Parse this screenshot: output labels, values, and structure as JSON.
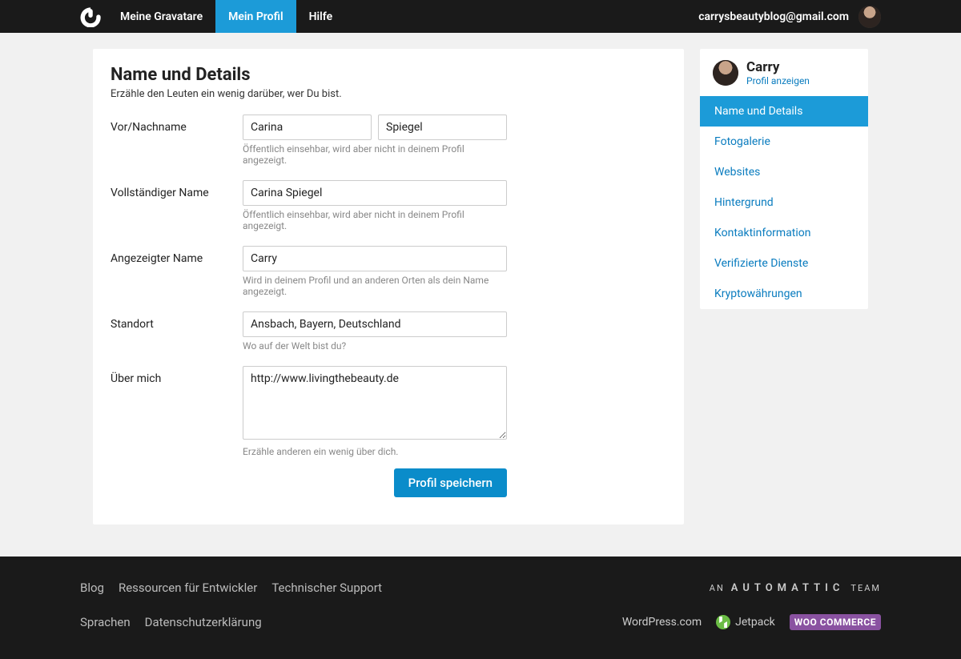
{
  "nav": {
    "items": [
      {
        "label": "Meine Gravatare",
        "active": false
      },
      {
        "label": "Mein Profil",
        "active": true
      },
      {
        "label": "Hilfe",
        "active": false
      }
    ],
    "user_email": "carrysbeautyblog@gmail.com"
  },
  "page": {
    "title": "Name und Details",
    "subtitle": "Erzähle den Leuten ein wenig darüber, wer Du bist."
  },
  "form": {
    "first_last": {
      "label": "Vor/Nachname",
      "first_value": "Carina",
      "last_value": "Spiegel",
      "hint": "Öffentlich einsehbar, wird aber nicht in deinem Profil angezeigt."
    },
    "full_name": {
      "label": "Vollständiger Name",
      "value": "Carina Spiegel",
      "hint": "Öffentlich einsehbar, wird aber nicht in deinem Profil angezeigt."
    },
    "display_name": {
      "label": "Angezeigter Name",
      "value": "Carry",
      "hint": "Wird in deinem Profil und an anderen Orten als dein Name angezeigt."
    },
    "location": {
      "label": "Standort",
      "value": "Ansbach, Bayern, Deutschland",
      "hint": "Wo auf der Welt bist du?"
    },
    "about": {
      "label": "Über mich",
      "value": "http://www.livingthebeauty.de",
      "hint": "Erzähle anderen ein wenig über dich."
    },
    "save_label": "Profil speichern"
  },
  "sidebar": {
    "user_name": "Carry",
    "profile_link_label": "Profil anzeigen",
    "items": [
      {
        "label": "Name und Details",
        "active": true
      },
      {
        "label": "Fotogalerie",
        "active": false
      },
      {
        "label": "Websites",
        "active": false
      },
      {
        "label": "Hintergrund",
        "active": false
      },
      {
        "label": "Kontaktinformation",
        "active": false
      },
      {
        "label": "Verifizierte Dienste",
        "active": false
      },
      {
        "label": "Kryptowährungen",
        "active": false
      }
    ]
  },
  "footer": {
    "row1": [
      "Blog",
      "Ressourcen für Entwickler",
      "Technischer Support"
    ],
    "team_prefix": "AN",
    "team_brand": "AUTOMATTIC",
    "team_suffix": "TEAM",
    "row2": [
      "Sprachen",
      "Datenschutzerklärung"
    ],
    "brands": {
      "wordpress": "WordPress.com",
      "jetpack": "Jetpack",
      "woo": "WOO COMMERCE"
    }
  }
}
